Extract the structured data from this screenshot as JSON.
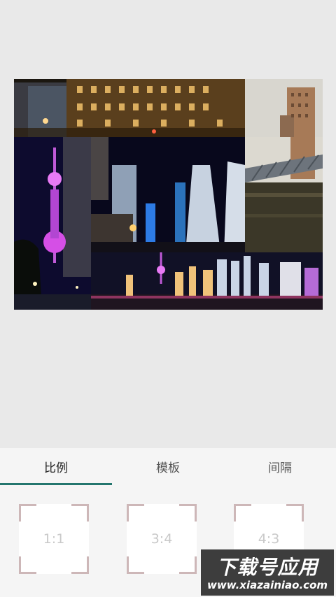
{
  "collage": {
    "photos": [
      {
        "name": "bund-street-buildings"
      },
      {
        "name": "bridge-and-tower"
      },
      {
        "name": "oriental-pearl-tower-purple"
      },
      {
        "name": "skyscrapers-night"
      },
      {
        "name": "river-bridge-water"
      },
      {
        "name": "pudong-skyline-panorama"
      }
    ]
  },
  "panel": {
    "tabs": [
      {
        "label": "比例",
        "active": true
      },
      {
        "label": "模板",
        "active": false
      },
      {
        "label": "间隔",
        "active": false
      }
    ],
    "ratios": [
      {
        "label": "1:1"
      },
      {
        "label": "3:4"
      },
      {
        "label": "4:3"
      }
    ]
  },
  "watermark": {
    "cn": "下载号应用",
    "en": "www.xiazainiao.com"
  },
  "colors": {
    "accent": "#24766e",
    "background": "#e9e9e9",
    "panel": "#f5f5f5",
    "corner": "#cdb7b8"
  }
}
